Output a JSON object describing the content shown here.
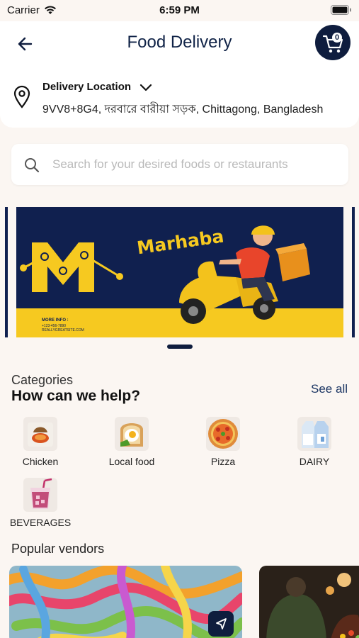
{
  "status_bar": {
    "carrier": "Carrier",
    "time": "6:59 PM"
  },
  "header": {
    "title": "Food Delivery",
    "cart_count": "0"
  },
  "location": {
    "label": "Delivery Location",
    "address": "9VV8+8G4, দরবারে বারীয়া সড়ক, Chittagong, Bangladesh"
  },
  "search": {
    "placeholder": "Search for your desired foods or restaurants"
  },
  "banner": {
    "brand": "Marhaba",
    "info_title": "MORE INFO :",
    "info_lines": [
      "+123-456-7890",
      "REALLYGREATSITE.COM"
    ],
    "colors": {
      "navy": "#10204f",
      "yellow": "#f6c920"
    }
  },
  "categories": {
    "subtitle": "Categories",
    "heading": "How can we help?",
    "see_all": "See all",
    "items": [
      {
        "label": "Chicken",
        "icon": "chicken-dish-icon"
      },
      {
        "label": "Local food",
        "icon": "toast-egg-icon"
      },
      {
        "label": "Pizza",
        "icon": "pizza-icon"
      },
      {
        "label": "DAIRY",
        "icon": "milk-carton-icon"
      },
      {
        "label": "BEVERAGES",
        "icon": "drink-cup-icon"
      }
    ]
  },
  "vendors": {
    "title": "Popular vendors"
  }
}
